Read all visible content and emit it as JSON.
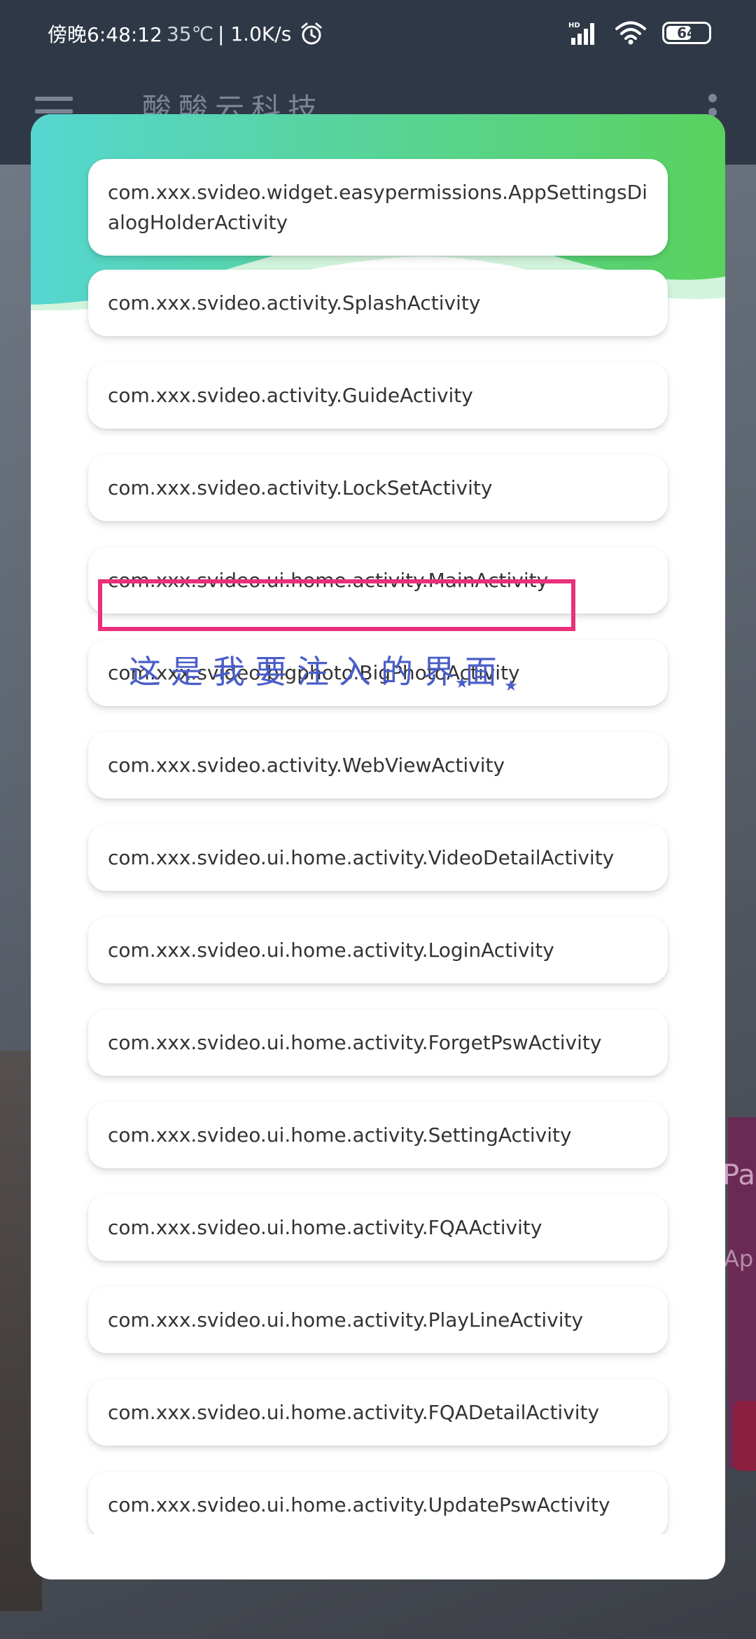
{
  "status_bar": {
    "time": "傍晚6:48:12",
    "temperature": "35℃",
    "network_speed": "| 1.0K/s",
    "battery_level": "64",
    "signal_label": "HD"
  },
  "background_app": {
    "title": "酸酸云科技",
    "banner_text_1": "Pa",
    "banner_text_2": "Ap"
  },
  "dialog": {
    "items": [
      "com.xxx.svideo.widget.easypermissions.AppSettingsDialogHolderActivity",
      "com.xxx.svideo.activity.SplashActivity",
      "com.xxx.svideo.activity.GuideActivity",
      "com.xxx.svideo.activity.LockSetActivity",
      "com.xxx.svideo.ui.home.activity.MainActivity",
      "com.xxx.svideo.bigphoto.BigPhotoActivity",
      "com.xxx.svideo.activity.WebViewActivity",
      "com.xxx.svideo.ui.home.activity.VideoDetailActivity",
      "com.xxx.svideo.ui.home.activity.LoginActivity",
      "com.xxx.svideo.ui.home.activity.ForgetPswActivity",
      "com.xxx.svideo.ui.home.activity.SettingActivity",
      "com.xxx.svideo.ui.home.activity.FQAActivity",
      "com.xxx.svideo.ui.home.activity.PlayLineActivity",
      "com.xxx.svideo.ui.home.activity.FQADetailActivity",
      "com.xxx.svideo.ui.home.activity.UpdatePswActivity"
    ],
    "annotation": "这是我要注入的界面"
  },
  "colors": {
    "highlight": "#e8317a",
    "annotation": "#4a5ec8",
    "header_gradient_start": "#56d6d0",
    "header_gradient_end": "#5ad25e"
  }
}
